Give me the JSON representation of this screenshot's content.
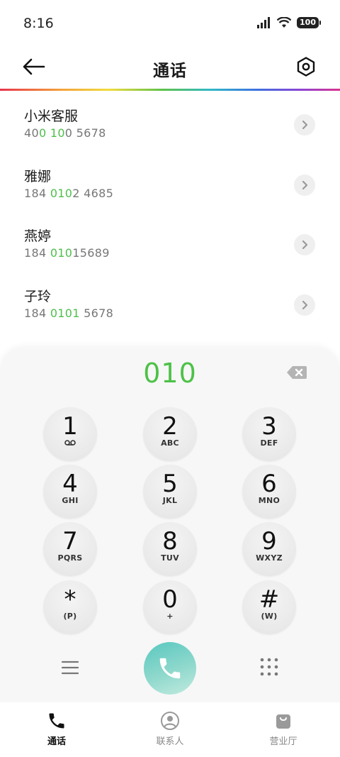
{
  "status_bar": {
    "time": "8:16",
    "battery": "100"
  },
  "header": {
    "title": "通话"
  },
  "results": [
    {
      "name": "小米客服",
      "number_parts": [
        "40",
        "0 10",
        "0 5678"
      ]
    },
    {
      "name": "雅娜",
      "number_parts": [
        "184 ",
        "010",
        "2 4685"
      ]
    },
    {
      "name": "燕婷",
      "number_parts": [
        "184 ",
        "010",
        "15689"
      ]
    },
    {
      "name": "子玲",
      "number_parts": [
        "184 ",
        "0101",
        " 5678"
      ]
    }
  ],
  "dialpad": {
    "dialed": "010",
    "keys": [
      {
        "digit": "1",
        "sub": ""
      },
      {
        "digit": "2",
        "sub": "ABC"
      },
      {
        "digit": "3",
        "sub": "DEF"
      },
      {
        "digit": "4",
        "sub": "GHI"
      },
      {
        "digit": "5",
        "sub": "JKL"
      },
      {
        "digit": "6",
        "sub": "MNO"
      },
      {
        "digit": "7",
        "sub": "PQRS"
      },
      {
        "digit": "8",
        "sub": "TUV"
      },
      {
        "digit": "9",
        "sub": "WXYZ"
      },
      {
        "digit": "*",
        "sub": "(P)"
      },
      {
        "digit": "0",
        "sub": "+"
      },
      {
        "digit": "#",
        "sub": "(W)"
      }
    ]
  },
  "bottom_nav": [
    {
      "label": "通话",
      "icon": "phone-icon",
      "active": true
    },
    {
      "label": "联系人",
      "icon": "person-icon",
      "active": false
    },
    {
      "label": "营业厅",
      "icon": "shopping-bag-icon",
      "active": false
    }
  ],
  "colors": {
    "accent_green": "#4cc246",
    "call_button": "#58c8c0"
  }
}
